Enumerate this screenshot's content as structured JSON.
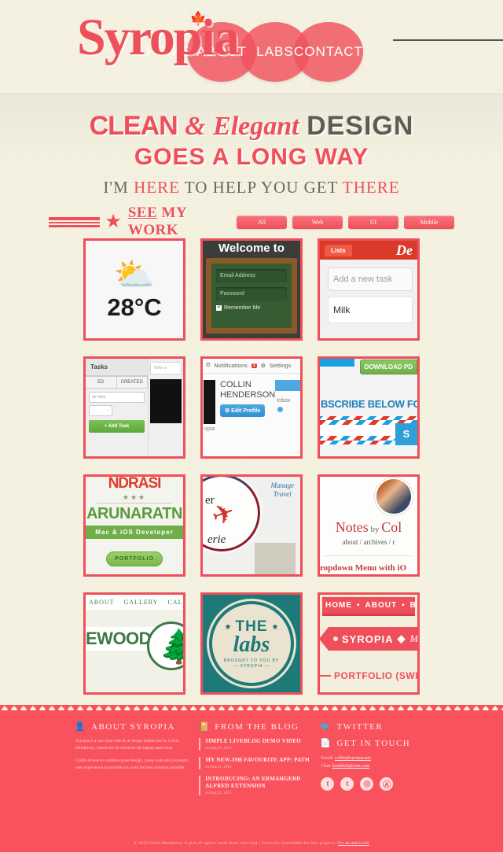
{
  "site": {
    "logo": "Syropia",
    "logo_leaf_icon": "maple-leaf-icon"
  },
  "nav": {
    "items": [
      {
        "label": "HOME"
      },
      {
        "label": "ABOUT"
      },
      {
        "label": "LABS"
      },
      {
        "label": "CONTACT"
      }
    ]
  },
  "hero": {
    "line1_a": "CLEAN",
    "line1_amp": "&",
    "line1_script": "Elegant",
    "line1_b": "DESIGN",
    "line2": "GOES A LONG WAY",
    "line3_a": "I'M ",
    "line3_hl1": "HERE",
    "line3_b": " TO HELP YOU GET ",
    "line3_hl2": "THERE"
  },
  "work": {
    "title_a": "SEE",
    "title_b": " MY WORK",
    "star_icon": "star-icon",
    "filters": [
      {
        "label": "All"
      },
      {
        "label": "Web"
      },
      {
        "label": "UI"
      },
      {
        "label": "Mobile"
      }
    ]
  },
  "portfolio": {
    "weather": {
      "icon": "sun-cloud-icon",
      "temp": "28°C"
    },
    "login": {
      "welcome": "Welcome to",
      "email": "Email Address",
      "password": "Password",
      "remember": "Remember Me",
      "check_icon": "checkmark-icon"
    },
    "todo": {
      "tab": "Lists",
      "brand": "De",
      "new_task_placeholder": "Add a new task",
      "task": "Milk"
    },
    "tasks": {
      "header": "Tasks",
      "seg1": "ED",
      "seg2": "CREATED",
      "input": "sk Here",
      "select": "↕",
      "add_button": "+ Add Task",
      "note": "Write a"
    },
    "profile": {
      "notifications": "Notifications",
      "notif_count": "3",
      "settings": "Settings",
      "name_line1": "COLLIN",
      "name_line2": "HENDERSON",
      "edit_button": "Edit Profile",
      "inbox": "Inbox",
      "footer": "opia",
      "bell_icon": "clock-icon",
      "gear_icon": "gear-icon"
    },
    "newsletter": {
      "download": "DOWNLOAD PD",
      "headline": "BSCRIBE BELOW FOR NEW",
      "submit": "S"
    },
    "dev": {
      "name_top": "NDRASI",
      "stars": "★★★",
      "name_big": "ARUNARATN",
      "role": "Mac & iOS Developer",
      "button": "PORTFOLIO"
    },
    "travel": {
      "manage_line1": "Manage",
      "manage_line2": "Travel",
      "word1": "er",
      "word2": "erie",
      "plane_icon": "airplane-icon"
    },
    "notes": {
      "title": "Notes",
      "by": " by ",
      "author": "Col",
      "subnav": "about / archives / r",
      "post": "ropdown Menu with iO",
      "avatar_icon": "avatar-photo"
    },
    "wood": {
      "menu": [
        "ABOUT",
        "GALLERY",
        "CALEND"
      ],
      "name": "EWOOD",
      "tree_icon": "pine-tree-icon"
    },
    "labs": {
      "the": "THE",
      "labs": "labs",
      "tagline": "BROUGHT TO YOU BY",
      "brand": "— SYROPIA —",
      "star_icon": "star-icon"
    },
    "tag": {
      "menu": [
        "HOME",
        "ABOUT",
        "BLO"
      ],
      "tag_text": "SYROPIA",
      "tag_script": "M",
      "portfolio": "PORTFOLIO (SWIPE T"
    }
  },
  "footer": {
    "about": {
      "heading": "ABOUT SYROPIA",
      "icon": "person-icon",
      "para1": "Syropia is a one-man web & ui design studio run by Collin Henderson, based out of wherever his laptop takes him.",
      "para2": "Collin strives to combine great design, clean code and a smooth user experience to provide you with the best solution possible."
    },
    "blog": {
      "heading": "FROM THE BLOG",
      "icon": "book-icon",
      "posts": [
        {
          "title": "SIMPLE LIVEBLOG DEMO VIDEO",
          "date": "on Aug 25, 2012"
        },
        {
          "title": "MY NEW-ISH FAVOURITE APP: PATH",
          "date": "on Aug 23, 2012"
        },
        {
          "title": "INTRODUCING: AN ERMAHGERD ALFRED EXTENSION",
          "date": "on Aug 21, 2012"
        }
      ]
    },
    "twitter": {
      "heading": "TWITTER",
      "icon": "twitter-bird-icon"
    },
    "contact": {
      "heading": "GET IN TOUCH",
      "icon": "contact-card-icon",
      "email_label": "Email:",
      "email_value": "collin@syropia.net",
      "chat_label": "Chat:",
      "chat_value": "kendrick@aim.com",
      "social": [
        {
          "name": "twitter-icon",
          "glyph": "t"
        },
        {
          "name": "tumblr-icon",
          "glyph": "t"
        },
        {
          "name": "dribbble-icon",
          "glyph": "◎"
        },
        {
          "name": "appnet-icon",
          "glyph": "Ⓐ"
        }
      ]
    },
    "copyright_a": "© 2012 Collin Henderson. A pick of raptors await those who read. | Currently unavailable for new projects | ",
    "copyright_link": "Go on and scroll"
  },
  "colors": {
    "accent": "#ef4f5a",
    "footer_bg": "#f9525c",
    "page_bg": "#f4f1e1",
    "teal": "#1d7a78",
    "green": "#6fae49"
  }
}
